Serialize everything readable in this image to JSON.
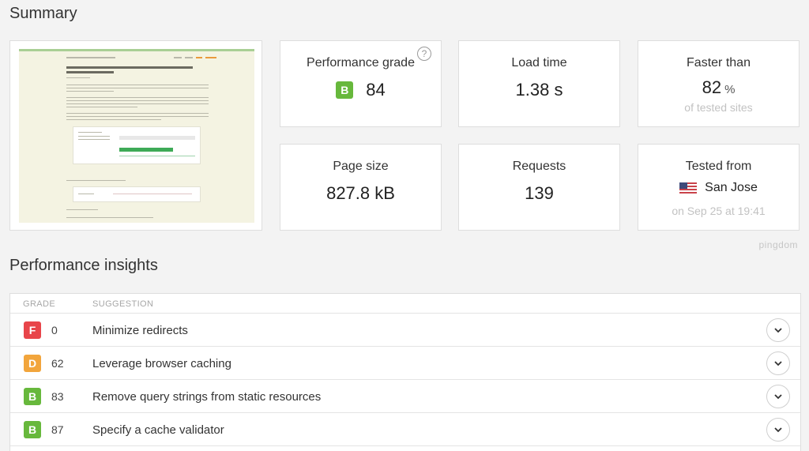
{
  "summary": {
    "title": "Summary",
    "thumbnail": {
      "name": "website-screenshot"
    },
    "cards": {
      "performance_grade": {
        "label": "Performance grade",
        "grade": "B",
        "value": "84",
        "help": "?"
      },
      "load_time": {
        "label": "Load time",
        "value": "1.38 s"
      },
      "faster_than": {
        "label": "Faster than",
        "value": "82",
        "unit": "%",
        "sub": "of tested sites"
      },
      "page_size": {
        "label": "Page size",
        "value": "827.8 kB"
      },
      "requests": {
        "label": "Requests",
        "value": "139"
      },
      "tested_from": {
        "label": "Tested from",
        "location": "San Jose",
        "sub": "on Sep 25 at 19:41",
        "flag_icon": "us-flag-icon"
      }
    },
    "brand": "pingdom"
  },
  "insights": {
    "title": "Performance insights",
    "columns": {
      "grade": "GRADE",
      "suggestion": "SUGGESTION"
    },
    "rows": [
      {
        "grade": "F",
        "score": "0",
        "suggestion": "Minimize redirects",
        "color": "#e8454a"
      },
      {
        "grade": "D",
        "score": "62",
        "suggestion": "Leverage browser caching",
        "color": "#f2a53c"
      },
      {
        "grade": "B",
        "score": "83",
        "suggestion": "Remove query strings from static resources",
        "color": "#67b83c"
      },
      {
        "grade": "B",
        "score": "87",
        "suggestion": "Specify a cache validator",
        "color": "#67b83c"
      }
    ]
  },
  "colors": {
    "grade_b": "#67b83c",
    "grade_d": "#f2a53c",
    "grade_f": "#e8454a",
    "muted": "#c2c2c2"
  }
}
